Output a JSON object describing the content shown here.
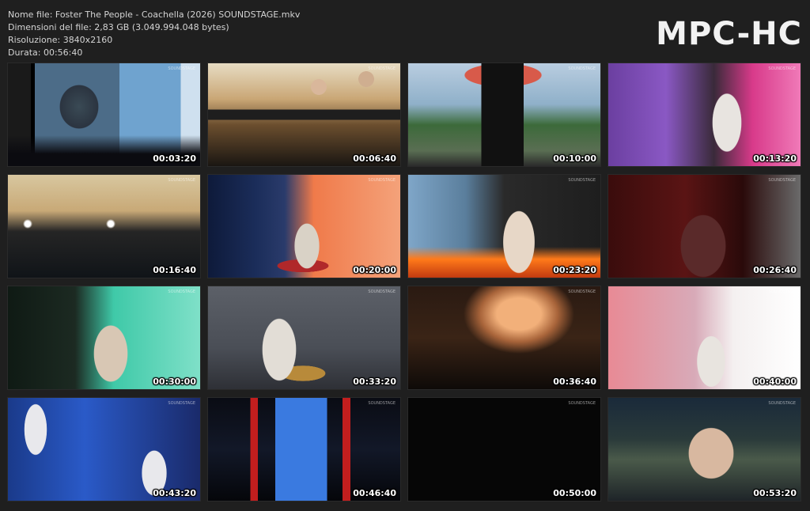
{
  "info": {
    "file_name": "Nome file: Foster The People - Coachella (2026) SOUNDSTAGE.mkv",
    "file_size": "Dimensioni del file: 2,83 GB (3.049.994.048 bytes)",
    "resolution": "Risoluzione: 3840x2160",
    "duration": "Durata: 00:56:40"
  },
  "logo": "MPC-HC",
  "thumbnails": [
    {
      "time": "00:03:20",
      "scene": "outdoor-stage-daylight"
    },
    {
      "time": "00:06:40",
      "scene": "band-keyboard-stage"
    },
    {
      "time": "00:10:00",
      "scene": "singer-black-outfit-billboard"
    },
    {
      "time": "00:13:20",
      "scene": "singer-purple-backdrop"
    },
    {
      "time": "00:16:40",
      "scene": "wide-stage-crowd"
    },
    {
      "time": "00:20:00",
      "scene": "singer-red-guitar-night"
    },
    {
      "time": "00:23:20",
      "scene": "singer-fire-backdrop"
    },
    {
      "time": "00:26:40",
      "scene": "singer-red-tinted"
    },
    {
      "time": "00:30:00",
      "scene": "guitarist-teal-screen"
    },
    {
      "time": "00:33:20",
      "scene": "guitarist-grey-backdrop"
    },
    {
      "time": "00:36:40",
      "scene": "orange-lit-set-wide"
    },
    {
      "time": "00:40:00",
      "scene": "singer-arms-raised-white"
    },
    {
      "time": "00:43:20",
      "scene": "band-blue-light"
    },
    {
      "time": "00:46:40",
      "scene": "dark-stage-blue-screen"
    },
    {
      "time": "00:50:00",
      "scene": "black-frame"
    },
    {
      "time": "00:53:20",
      "scene": "singer-closeup-crowd"
    }
  ]
}
